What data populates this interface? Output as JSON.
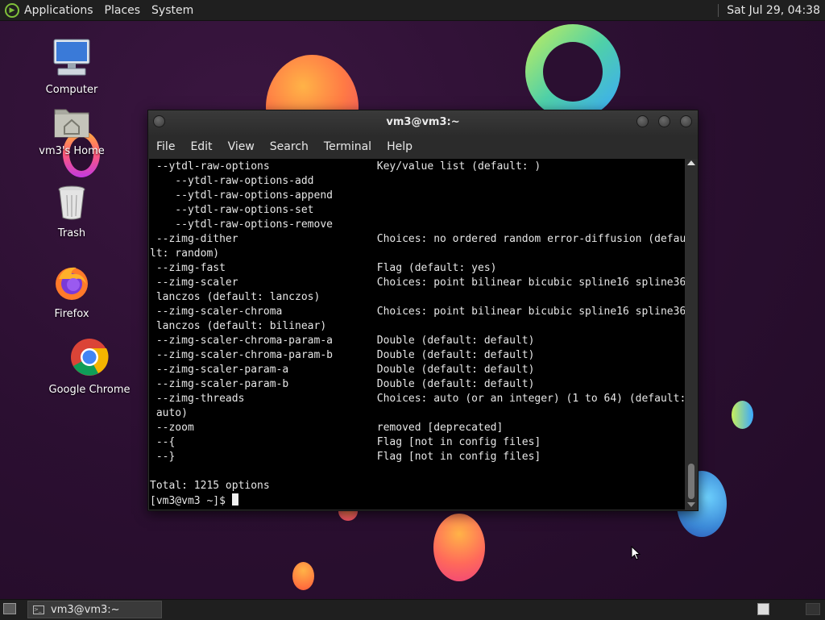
{
  "top_panel": {
    "menus": [
      "Applications",
      "Places",
      "System"
    ],
    "clock": "Sat Jul 29, 04:38"
  },
  "desktop_icons": {
    "computer": "Computer",
    "home": "vm3's Home",
    "trash": "Trash",
    "firefox": "Firefox",
    "chrome": "Google Chrome"
  },
  "terminal": {
    "title": "vm3@vm3:~",
    "menu": [
      "File",
      "Edit",
      "View",
      "Search",
      "Terminal",
      "Help"
    ],
    "lines": [
      " --ytdl-raw-options                 Key/value list (default: )",
      "    --ytdl-raw-options-add",
      "    --ytdl-raw-options-append",
      "    --ytdl-raw-options-set",
      "    --ytdl-raw-options-remove",
      " --zimg-dither                      Choices: no ordered random error-diffusion (defau",
      "lt: random)",
      " --zimg-fast                        Flag (default: yes)",
      " --zimg-scaler                      Choices: point bilinear bicubic spline16 spline36",
      " lanczos (default: lanczos)",
      " --zimg-scaler-chroma               Choices: point bilinear bicubic spline16 spline36",
      " lanczos (default: bilinear)",
      " --zimg-scaler-chroma-param-a       Double (default: default)",
      " --zimg-scaler-chroma-param-b       Double (default: default)",
      " --zimg-scaler-param-a              Double (default: default)",
      " --zimg-scaler-param-b              Double (default: default)",
      " --zimg-threads                     Choices: auto (or an integer) (1 to 64) (default:",
      " auto)",
      " --zoom                             removed [deprecated]",
      " --{                                Flag [not in config files]",
      " --}                                Flag [not in config files]",
      "",
      "Total: 1215 options"
    ],
    "prompt": "[vm3@vm3 ~]$ "
  },
  "taskbar": {
    "task_label": "vm3@vm3:~"
  },
  "colors": {
    "terminal_bg": "#000000",
    "terminal_fg": "#e6e6e6",
    "panel_bg": "#1f1f1f"
  }
}
